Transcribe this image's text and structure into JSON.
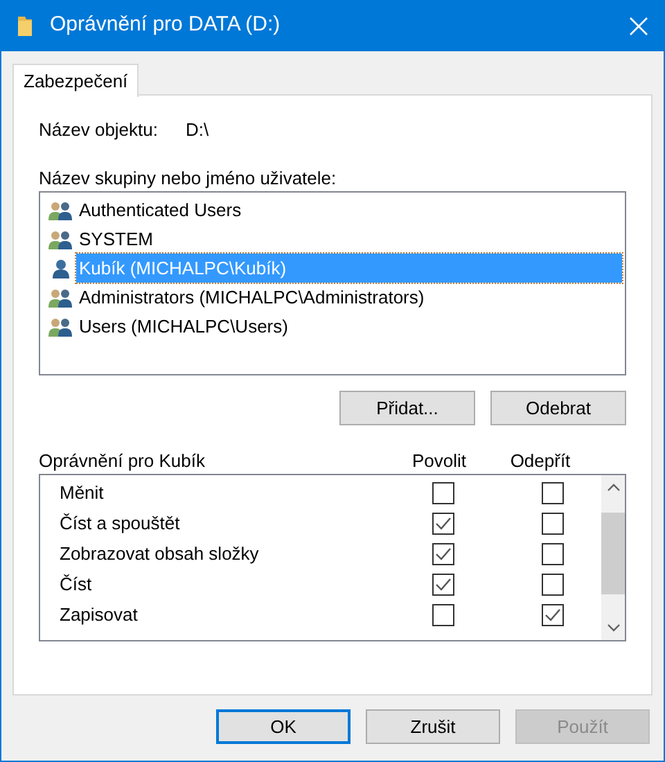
{
  "window": {
    "title": "Oprávnění pro DATA (D:)"
  },
  "tabs": [
    {
      "label": "Zabezpečení",
      "selected": true
    }
  ],
  "object_name": {
    "label": "Název objektu:",
    "value": "D:\\"
  },
  "principals": {
    "label": "Název skupiny nebo jméno uživatele:",
    "items": [
      {
        "name": "Authenticated Users",
        "kind": "group",
        "selected": false
      },
      {
        "name": "SYSTEM",
        "kind": "group",
        "selected": false
      },
      {
        "name": "Kubík (MICHALPC\\Kubík)",
        "kind": "user",
        "selected": true
      },
      {
        "name": "Administrators (MICHALPC\\Administrators)",
        "kind": "group",
        "selected": false
      },
      {
        "name": "Users (MICHALPC\\Users)",
        "kind": "group",
        "selected": false
      }
    ]
  },
  "principal_buttons": [
    "Přidat...",
    "Odebrat"
  ],
  "permissions": {
    "label": "Oprávnění pro Kubík",
    "columns": [
      "Povolit",
      "Odepřít"
    ],
    "rows": [
      {
        "name": "Měnit",
        "allow": false,
        "deny": false
      },
      {
        "name": "Číst a spouštět",
        "allow": true,
        "deny": false
      },
      {
        "name": "Zobrazovat obsah složky",
        "allow": true,
        "deny": false
      },
      {
        "name": "Číst",
        "allow": true,
        "deny": false
      },
      {
        "name": "Zapisovat",
        "allow": false,
        "deny": true
      }
    ]
  },
  "buttons": [
    {
      "label": "OK",
      "default": true,
      "disabled": false
    },
    {
      "label": "Zrušit",
      "default": false,
      "disabled": false
    },
    {
      "label": "Použít",
      "default": false,
      "disabled": true
    }
  ]
}
